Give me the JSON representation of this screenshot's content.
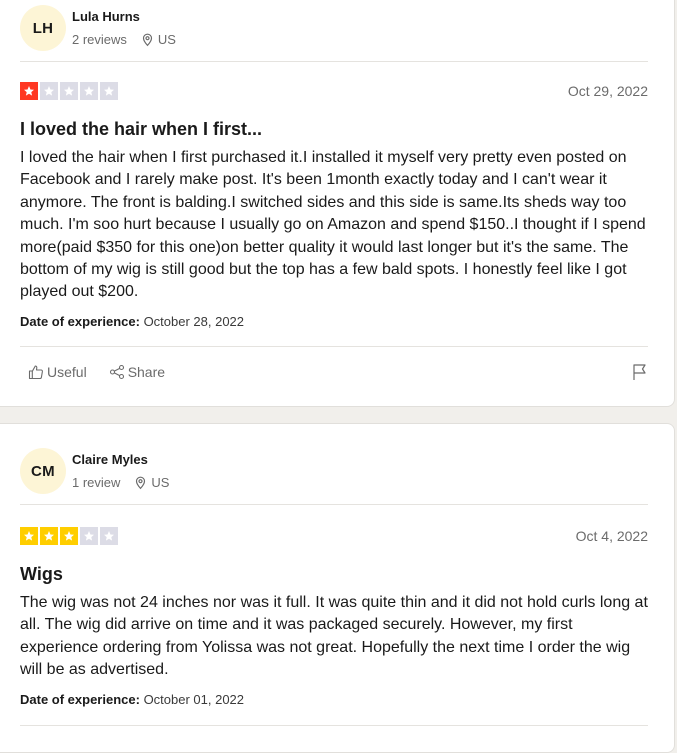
{
  "reviews": [
    {
      "initials": "LH",
      "name": "Lula Hurns",
      "review_count": "2 reviews",
      "country": "US",
      "rating": 1,
      "date": "Oct 29, 2022",
      "title": "I loved the hair when I first...",
      "body": "I loved the hair when I first purchased it.I installed it myself very pretty even posted on Facebook and I rarely make post. It's been 1month exactly today and I can't wear it anymore. The front is balding.I switched sides and this side is same.Its sheds way too much. I'm soo hurt because I usually go on Amazon and spend $150..I thought if I spend more(paid $350 for this one)on better quality it would last longer but it's the same. The bottom of my wig is still good but the top has a few bald spots. I honestly feel like I got played out $200.",
      "experience_label": "Date of experience:",
      "experience_date": "October 28, 2022",
      "useful_label": "Useful",
      "share_label": "Share"
    },
    {
      "initials": "CM",
      "name": "Claire Myles",
      "review_count": "1 review",
      "country": "US",
      "rating": 3,
      "date": "Oct 4, 2022",
      "title": "Wigs",
      "body": "The wig was not 24 inches nor was it full. It was quite thin and it did not hold curls long at all. The wig did arrive on time and it was packaged securely. However, my first experience ordering from Yolissa was not great. Hopefully the next time I order the wig will be as advertised.",
      "experience_label": "Date of experience:",
      "experience_date": "October 01, 2022"
    }
  ],
  "colors": {
    "star_one": "#ff3722",
    "star_three": "#ffce00",
    "star_empty": "#dcdce6",
    "avatar_bg": "#fdf5d6"
  },
  "icons": [
    "location-pin-icon",
    "thumbs-up-icon",
    "share-icon",
    "flag-icon",
    "star-icon"
  ]
}
